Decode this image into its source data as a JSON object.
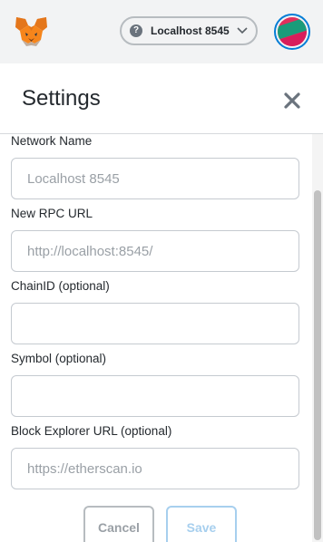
{
  "header": {
    "network": {
      "label": "Localhost 8545",
      "help_glyph": "?"
    },
    "logo_icon": "metamask-fox-icon",
    "avatar_icon": "account-identicon"
  },
  "settings": {
    "title": "Settings",
    "close_icon": "close-icon"
  },
  "form": {
    "network_name": {
      "label": "Network Name",
      "value": "",
      "placeholder": "Localhost 8545"
    },
    "rpc_url": {
      "label": "New RPC URL",
      "value": "",
      "placeholder": "http://localhost:8545/"
    },
    "chain_id": {
      "label": "ChainID (optional)",
      "value": "",
      "placeholder": ""
    },
    "symbol": {
      "label": "Symbol (optional)",
      "value": "",
      "placeholder": ""
    },
    "explorer_url": {
      "label": "Block Explorer URL (optional)",
      "value": "",
      "placeholder": "https://etherscan.io"
    }
  },
  "actions": {
    "cancel_label": "Cancel",
    "save_label": "Save"
  },
  "colors": {
    "accent_blue": "#037dd6",
    "save_disabled": "#a7cfee",
    "appbar_bg": "#f2f3f4"
  }
}
